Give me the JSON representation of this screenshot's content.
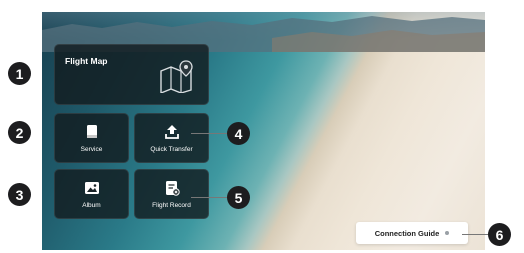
{
  "tiles": {
    "flight_map": "Flight Map",
    "service": "Service",
    "quick_transfer": "Quick Transfer",
    "album": "Album",
    "flight_record": "Flight Record"
  },
  "connection_guide": "Connection Guide",
  "callouts": [
    "1",
    "2",
    "3",
    "4",
    "5",
    "6"
  ],
  "icons": {
    "flight_map": "map-pin-icon",
    "service": "book-icon",
    "quick_transfer": "upload-icon",
    "album": "image-icon",
    "flight_record": "record-icon"
  }
}
